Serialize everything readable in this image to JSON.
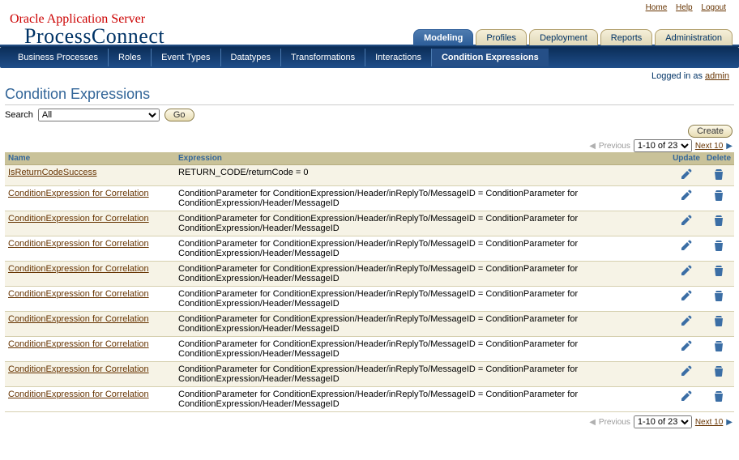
{
  "topLinks": {
    "home": "Home",
    "help": "Help",
    "logout": "Logout"
  },
  "branding": {
    "top": "Oracle Application Server",
    "sub": "ProcessConnect"
  },
  "mainTabs": {
    "modeling": "Modeling",
    "profiles": "Profiles",
    "deployment": "Deployment",
    "reports": "Reports",
    "administration": "Administration"
  },
  "subTabs": {
    "bp": "Business Processes",
    "roles": "Roles",
    "eventTypes": "Event Types",
    "datatypes": "Datatypes",
    "transformations": "Transformations",
    "interactions": "Interactions",
    "condExpr": "Condition Expressions"
  },
  "login": {
    "prefix": "Logged in as ",
    "user": "admin"
  },
  "page": {
    "title": "Condition Expressions"
  },
  "search": {
    "label": "Search",
    "options": [
      "All"
    ],
    "selected": "All",
    "goLabel": "Go"
  },
  "createLabel": "Create",
  "pager": {
    "previous": "Previous",
    "range": "1-10 of 23",
    "next": "Next 10"
  },
  "columns": {
    "name": "Name",
    "expression": "Expression",
    "update": "Update",
    "delete": "Delete"
  },
  "rows": [
    {
      "name": "IsReturnCodeSuccess",
      "expression": "RETURN_CODE/returnCode = 0"
    },
    {
      "name": "ConditionExpression for Correlation",
      "expression": "ConditionParameter for ConditionExpression/Header/inReplyTo/MessageID = ConditionParameter for ConditionExpression/Header/MessageID"
    },
    {
      "name": "ConditionExpression for Correlation",
      "expression": "ConditionParameter for ConditionExpression/Header/inReplyTo/MessageID = ConditionParameter for ConditionExpression/Header/MessageID"
    },
    {
      "name": "ConditionExpression for Correlation",
      "expression": "ConditionParameter for ConditionExpression/Header/inReplyTo/MessageID = ConditionParameter for ConditionExpression/Header/MessageID"
    },
    {
      "name": "ConditionExpression for Correlation",
      "expression": "ConditionParameter for ConditionExpression/Header/inReplyTo/MessageID = ConditionParameter for ConditionExpression/Header/MessageID"
    },
    {
      "name": "ConditionExpression for Correlation",
      "expression": "ConditionParameter for ConditionExpression/Header/inReplyTo/MessageID = ConditionParameter for ConditionExpression/Header/MessageID"
    },
    {
      "name": "ConditionExpression for Correlation",
      "expression": "ConditionParameter for ConditionExpression/Header/inReplyTo/MessageID = ConditionParameter for ConditionExpression/Header/MessageID"
    },
    {
      "name": "ConditionExpression for Correlation",
      "expression": "ConditionParameter for ConditionExpression/Header/inReplyTo/MessageID = ConditionParameter for ConditionExpression/Header/MessageID"
    },
    {
      "name": "ConditionExpression for Correlation",
      "expression": "ConditionParameter for ConditionExpression/Header/inReplyTo/MessageID = ConditionParameter for ConditionExpression/Header/MessageID"
    },
    {
      "name": "ConditionExpression for Correlation",
      "expression": "ConditionParameter for ConditionExpression/Header/inReplyTo/MessageID = ConditionParameter for ConditionExpression/Header/MessageID"
    }
  ]
}
